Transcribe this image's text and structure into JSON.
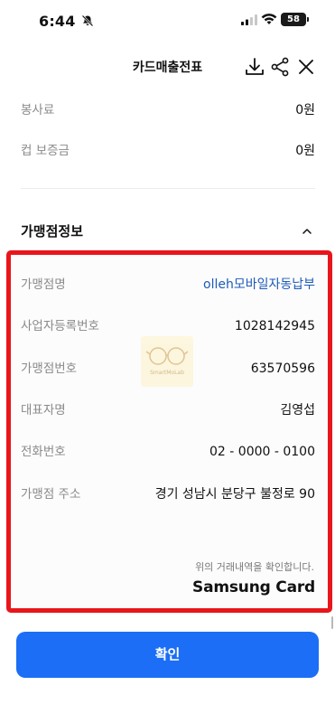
{
  "status_bar": {
    "time": "6:44",
    "battery": "58"
  },
  "header": {
    "title": "카드매출전표"
  },
  "top_rows": [
    {
      "label": "봉사료",
      "value": "0원"
    },
    {
      "label": "컵 보증금",
      "value": "0원"
    }
  ],
  "merchant_section": {
    "title": "가맹점정보",
    "rows": [
      {
        "label": "가맹점명",
        "value": "olleh모바일자동납부"
      },
      {
        "label": "사업자등록번호",
        "value": "1028142945"
      },
      {
        "label": "가맹점번호",
        "value": "63570596"
      },
      {
        "label": "대표자명",
        "value": "김영섭"
      },
      {
        "label": "전화번호",
        "value": "02 - 0000 - 0100"
      },
      {
        "label": "가맹점 주소",
        "value": "경기 성남시 분당구 불정로 90"
      }
    ],
    "confirm_note": "위의 거래내역을 확인합니다.",
    "brand": "Samsung Card"
  },
  "confirm_button": {
    "label": "확인"
  },
  "colors": {
    "highlight": "#e8161b",
    "button": "#1b6ef5",
    "merchant_link": "#1e5bb8"
  }
}
